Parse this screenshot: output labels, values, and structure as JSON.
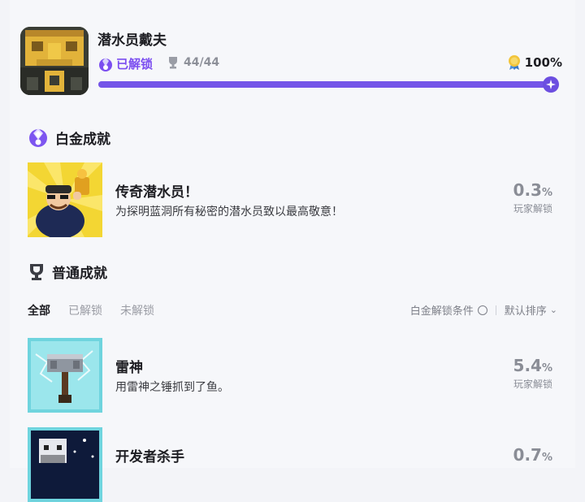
{
  "game": {
    "title": "潜水员戴夫",
    "unlocked_label": "已解锁",
    "trophy_count": "44/44",
    "percent_text": "100%",
    "progress": 1.0
  },
  "platinum_section": {
    "title": "白金成就",
    "item": {
      "name": "传奇潜水员！",
      "desc": "为探明蓝洞所有秘密的潜水员致以最高敬意！",
      "rate": "0.3",
      "rate_unit": "%",
      "rate_label": "玩家解锁"
    }
  },
  "normal_section": {
    "title": "普通成就",
    "tabs": [
      "全部",
      "已解锁",
      "未解锁"
    ],
    "platinum_condition": "白金解锁条件",
    "sort_label": "默认排序",
    "items": [
      {
        "name": "雷神",
        "desc": "用雷神之锤抓到了鱼。",
        "rate": "5.4",
        "rate_unit": "%",
        "rate_label": "玩家解锁"
      },
      {
        "name": "开发者杀手",
        "rate": "0.7",
        "rate_unit": "%"
      }
    ]
  },
  "colors": {
    "accent": "#7454e8",
    "track": "#dcd8f4",
    "muted": "#8a8d96"
  }
}
